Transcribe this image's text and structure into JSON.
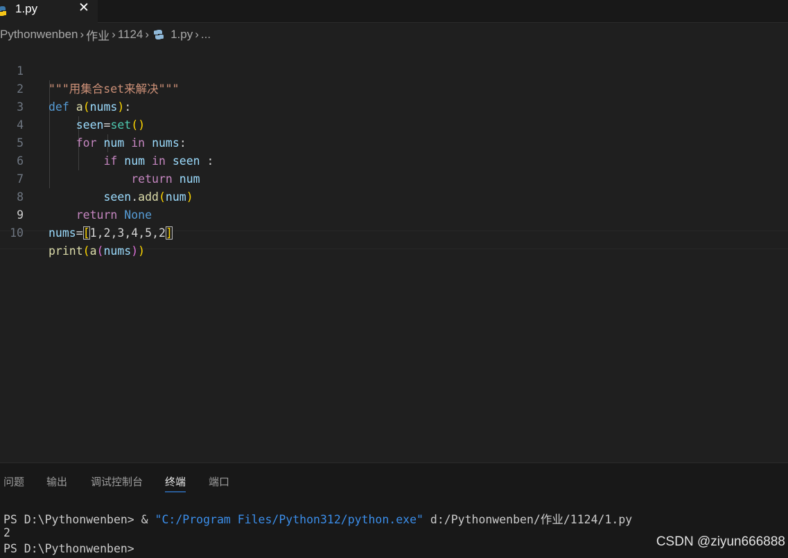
{
  "tab": {
    "label": "1.py",
    "close": "✕"
  },
  "breadcrumb": {
    "items": [
      "Pythonwenben",
      "作业",
      "1124",
      "1.py",
      "..."
    ],
    "separator": "›"
  },
  "editor": {
    "active_line": 9,
    "line_numbers": [
      "1",
      "2",
      "3",
      "4",
      "5",
      "6",
      "7",
      "8",
      "9",
      "10"
    ],
    "lines": [
      "\"\"\"用集合set来解决\"\"\"",
      "def a(nums):",
      "    seen=set()",
      "    for num in nums:",
      "        if num in seen :",
      "            return num",
      "        seen.add(num)",
      "    return None",
      "nums=[1,2,3,4,5,2]",
      "print(a(nums))"
    ]
  },
  "panel": {
    "tabs": [
      "问题",
      "输出",
      "调试控制台",
      "终端",
      "端口"
    ],
    "active_tab": "终端",
    "terminal": {
      "cmd_prompt": "PS D:\\Pythonwenben> & ",
      "cmd_exe": "\"C:/Program Files/Python312/python.exe\"",
      "cmd_arg": " d:/Pythonwenben/作业/1124/1.py",
      "output": "2",
      "prompt": "PS D:\\Pythonwenben>"
    }
  },
  "watermark": "CSDN @ziyun666888",
  "colors": {
    "background": "#1f1f1f",
    "keyword": "#569cd6",
    "control": "#c586c0",
    "function": "#dcdcaa",
    "variable": "#9cdcfe",
    "string": "#ce9178",
    "builtin_class": "#4ec9b0",
    "terminal_string": "#3b8eea"
  }
}
